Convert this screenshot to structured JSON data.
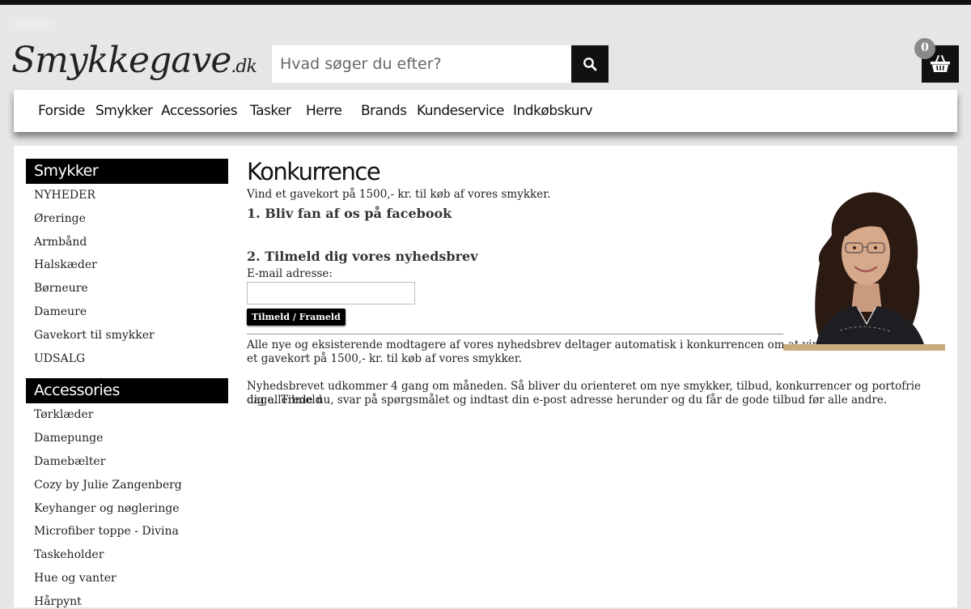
{
  "header": {
    "logo_text": "Smykkegave",
    "logo_suffix": ".dk",
    "search_placeholder": "Hvad søger du efter?",
    "cart_count": "0"
  },
  "nav": {
    "items": [
      "Forside",
      "Smykker",
      "Accessories",
      "Tasker",
      "Herre",
      "Brands",
      "Kundeservice",
      "Indkøbskurv"
    ]
  },
  "sidebar": {
    "sections": [
      {
        "title": "Smykker",
        "items": [
          "NYHEDER",
          "Øreringe",
          "Armbånd",
          "Halskæder",
          "Børneure",
          "Dameure",
          "Gavekort til smykker",
          "UDSALG"
        ]
      },
      {
        "title": "Accessories",
        "items": [
          "Tørklæder",
          "Damepunge",
          "Damebælter",
          "Cozy by Julie Zangenberg",
          "Keyhanger og nøgleringe",
          "Microfiber toppe - Divina",
          "Taskeholder",
          "Hue og vanter",
          "Hårpynt"
        ]
      }
    ]
  },
  "main": {
    "title": "Konkurrence",
    "intro": "Vind et gavekort på 1500,- kr. til køb af vores smykker.",
    "step1": "1. Bliv fan af os på facebook",
    "step2": "2. Tilmeld dig vores nyhedsbrev",
    "email_label": "E-mail adresse:",
    "email_value": "",
    "submit_label": "Tilmeld / Frameld",
    "para1_line1": "Alle nye og eksisterende modtagere af vores nyhedsbrev deltager automatisk i konkurrencen om at vinde",
    "para1_line2": "et gavekort på 1500,- kr. til køb af vores smykker.",
    "para2_line1": "Nyhedsbrevet udkommer 4 gang om måneden. Så bliver du orienteret om nye smykker, tilbud, konkurrencer og portofrie dage. Tilmeld",
    "para2_line2": "dig allerede nu, svar på spørgsmålet og indtast din e-post adresse herunder og du får de gode tilbud før alle andre."
  },
  "colors": {
    "accent": "#000000",
    "photo_base": "#c9ab7c",
    "cart_badge": "#8a8a8a"
  }
}
